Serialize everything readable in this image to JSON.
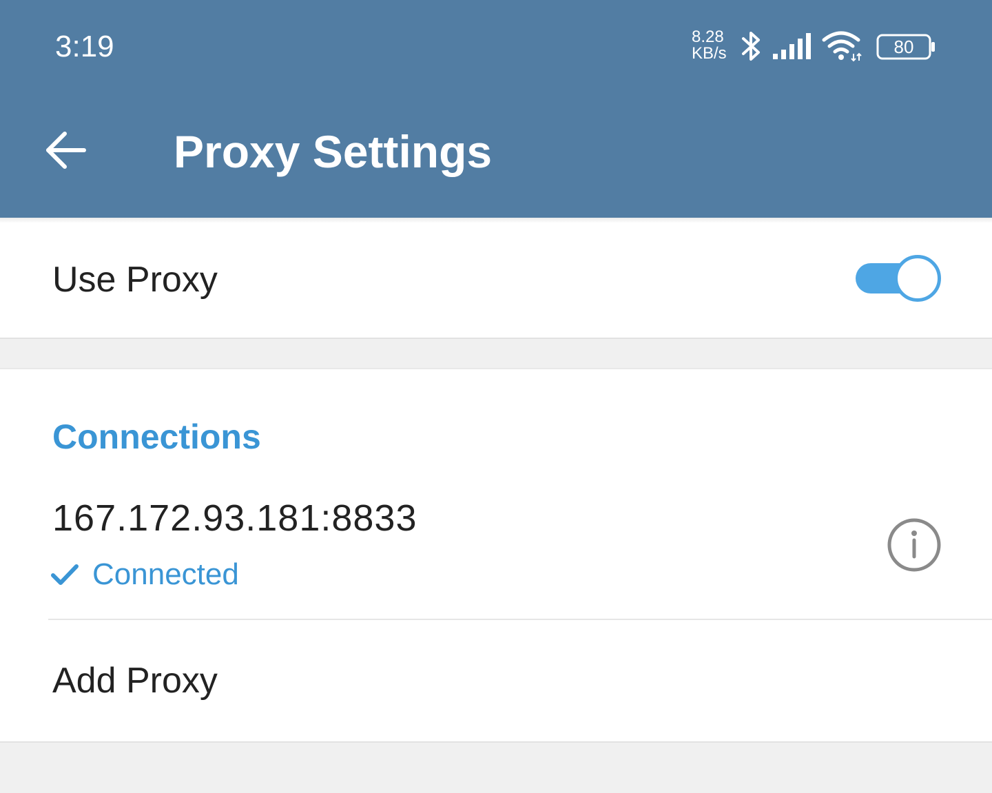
{
  "status_bar": {
    "time": "3:19",
    "net_speed_value": "8.28",
    "net_speed_unit": "KB/s",
    "battery_level": "80",
    "icons": [
      "bluetooth-icon",
      "cellular-signal-icon",
      "wifi-icon",
      "battery-icon"
    ]
  },
  "header": {
    "back_icon": "arrow-left-icon",
    "title": "Proxy Settings",
    "background_color": "#527da3"
  },
  "use_proxy": {
    "label": "Use Proxy",
    "enabled": true,
    "accent_color": "#4ea6e4"
  },
  "connections": {
    "section_title": "Connections",
    "items": [
      {
        "address": "167.172.93.181:8833",
        "status": "Connected",
        "status_icon": "checkmark-icon",
        "action_icon": "info-icon"
      }
    ],
    "add_label": "Add Proxy"
  }
}
